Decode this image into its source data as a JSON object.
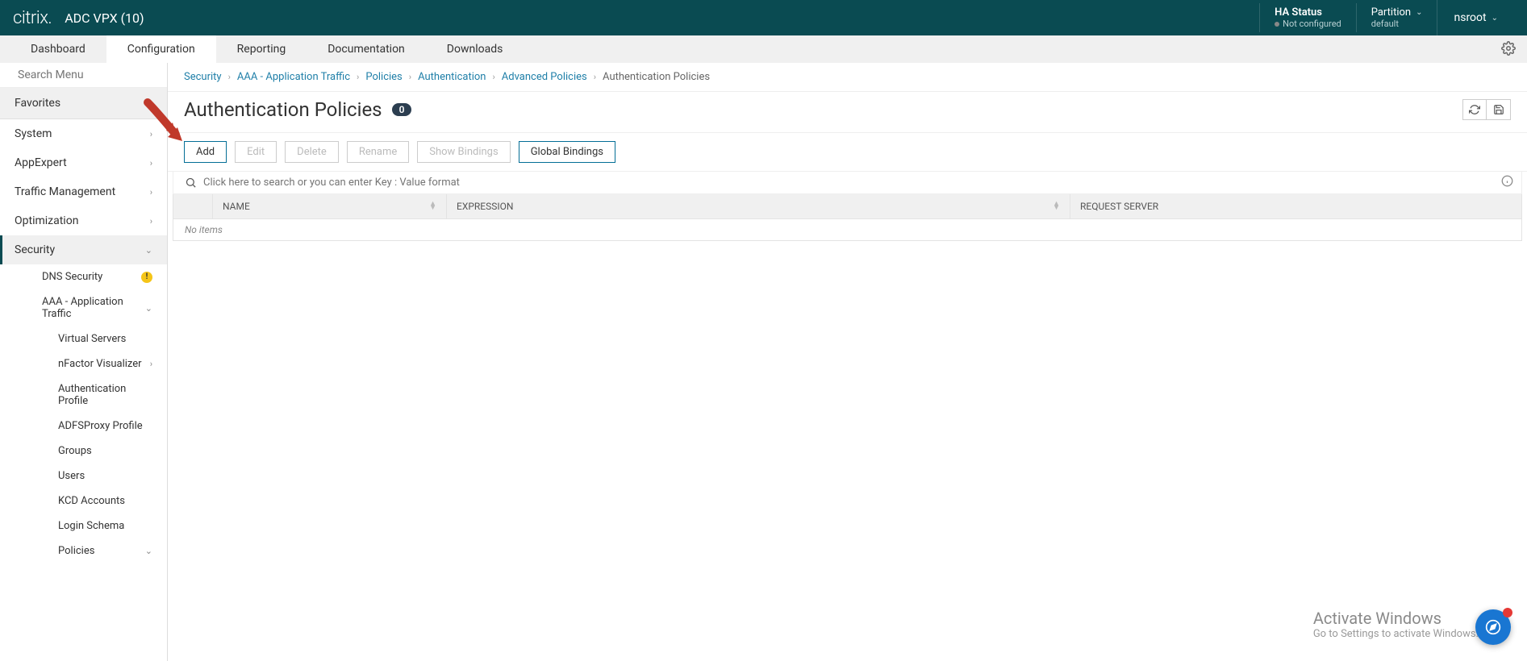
{
  "header": {
    "logo": "citrix.",
    "product": "ADC VPX (10)",
    "ha_label": "HA Status",
    "ha_value": "Not configured",
    "partition_label": "Partition",
    "partition_value": "default",
    "user": "nsroot"
  },
  "tabs": {
    "dashboard": "Dashboard",
    "configuration": "Configuration",
    "reporting": "Reporting",
    "documentation": "Documentation",
    "downloads": "Downloads"
  },
  "sidebar": {
    "search_placeholder": "Search Menu",
    "favorites": "Favorites",
    "items": {
      "system": "System",
      "appexpert": "AppExpert",
      "traffic": "Traffic Management",
      "optimization": "Optimization",
      "security": "Security"
    },
    "security_children": {
      "dns": "DNS Security",
      "aaa": "AAA - Application Traffic",
      "virtual_servers": "Virtual Servers",
      "nfactor": "nFactor Visualizer",
      "auth_profile": "Authentication Profile",
      "adfs": "ADFSProxy Profile",
      "groups": "Groups",
      "users": "Users",
      "kcd": "KCD Accounts",
      "login_schema": "Login Schema",
      "policies": "Policies"
    }
  },
  "breadcrumb": {
    "security": "Security",
    "aaa": "AAA - Application Traffic",
    "policies": "Policies",
    "authentication": "Authentication",
    "advanced": "Advanced Policies",
    "current": "Authentication Policies"
  },
  "page": {
    "title": "Authentication Policies",
    "count": "0"
  },
  "toolbar": {
    "add": "Add",
    "edit": "Edit",
    "delete": "Delete",
    "rename": "Rename",
    "show_bindings": "Show Bindings",
    "global_bindings": "Global Bindings"
  },
  "search": {
    "placeholder": "Click here to search or you can enter Key : Value format"
  },
  "table": {
    "col_name": "NAME",
    "col_expression": "EXPRESSION",
    "col_request_server": "REQUEST SERVER",
    "empty": "No items"
  },
  "watermark": {
    "l1": "Activate Windows",
    "l2": "Go to Settings to activate Windows."
  }
}
